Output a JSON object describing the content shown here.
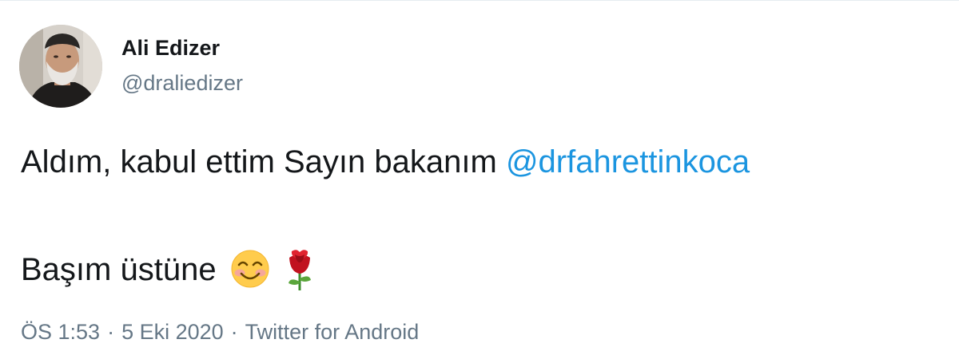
{
  "author": {
    "display_name": "Ali Edizer",
    "username": "@draliedizer"
  },
  "tweet": {
    "line1_text": "Aldım, kabul ettim Sayın bakanım ",
    "mention": "@drfahrettinkoca",
    "line2_text": "Başım üstüne",
    "emojis": [
      "smiling-face-with-smiling-eyes",
      "rose"
    ]
  },
  "meta": {
    "time": "ÖS 1:53",
    "separator": "·",
    "date": "5 Eki 2020",
    "source": "Twitter for Android"
  },
  "colors": {
    "link": "#1b95e0",
    "text": "#14171a",
    "secondary": "#657786"
  }
}
